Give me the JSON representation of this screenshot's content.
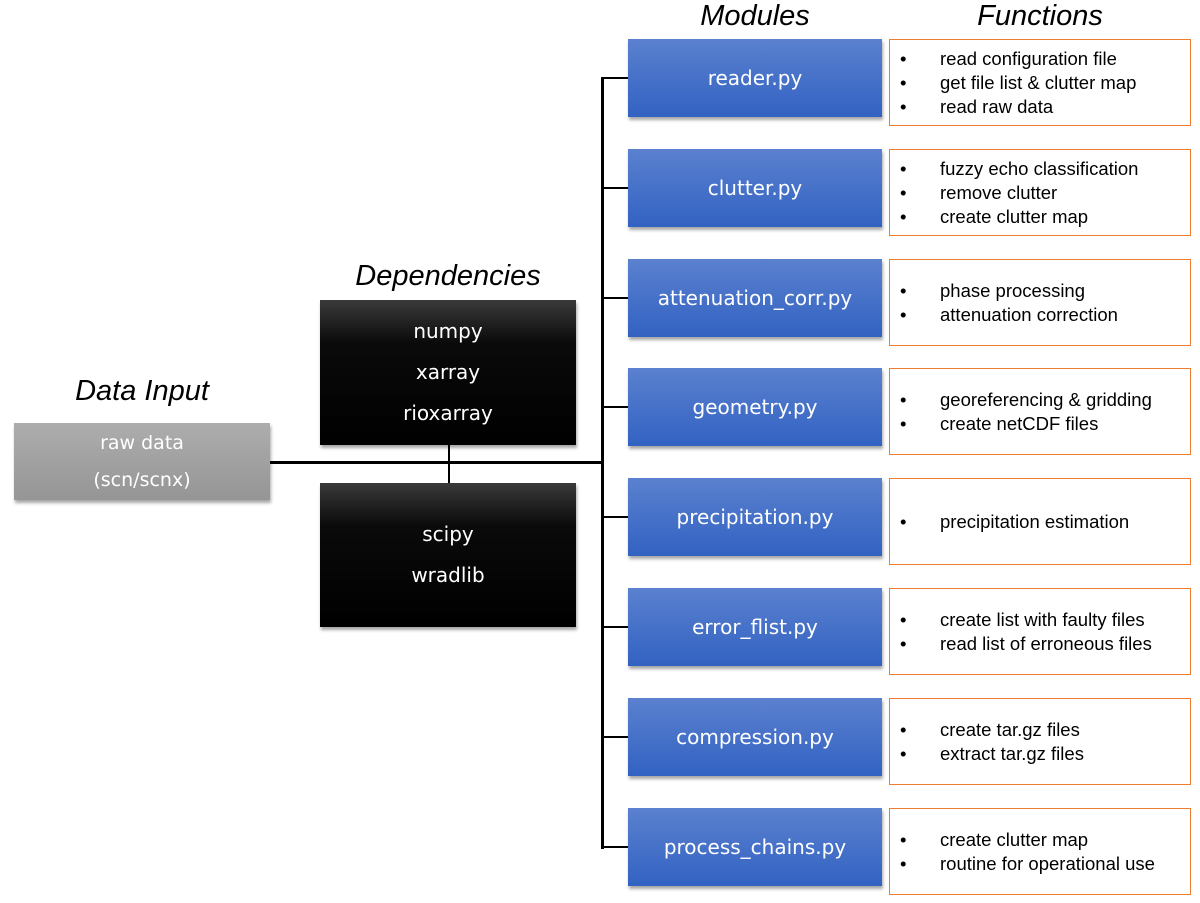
{
  "headings": {
    "data_input": "Data Input",
    "dependencies": "Dependencies",
    "modules": "Modules",
    "functions": "Functions"
  },
  "data_input": {
    "lines": [
      "raw data",
      "(scn/scnx)"
    ],
    "color": "#a0a0a0"
  },
  "dependencies": [
    {
      "items": [
        "numpy",
        "xarray",
        "rioxarray"
      ]
    },
    {
      "items": [
        "scipy",
        "wradlib"
      ]
    }
  ],
  "colors": {
    "module_fill": "#4472c4",
    "function_border": "#ed7d31",
    "dependency_fill": "#000000"
  },
  "modules": [
    {
      "name": "reader.py",
      "functions": [
        "read configuration file",
        "get file list & clutter map",
        "read raw data"
      ]
    },
    {
      "name": "clutter.py",
      "functions": [
        "fuzzy echo classification",
        "remove clutter",
        "create clutter map"
      ]
    },
    {
      "name": "attenuation_corr.py",
      "functions": [
        "phase processing",
        "attenuation correction"
      ]
    },
    {
      "name": "geometry.py",
      "functions": [
        "georeferencing & gridding",
        "create netCDF files"
      ]
    },
    {
      "name": "precipitation.py",
      "functions": [
        "precipitation estimation"
      ]
    },
    {
      "name": "error_flist.py",
      "functions": [
        "create list with faulty files",
        "read list of erroneous files"
      ]
    },
    {
      "name": "compression.py",
      "functions": [
        "create tar.gz files",
        "extract tar.gz files"
      ]
    },
    {
      "name": "process_chains.py",
      "functions": [
        "create clutter map",
        "routine for operational use"
      ]
    }
  ],
  "bullet_glyph": "•"
}
